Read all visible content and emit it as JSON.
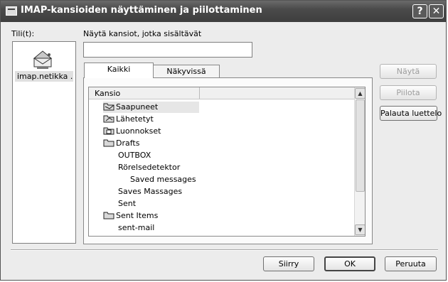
{
  "window": {
    "title": "IMAP-kansioiden näyttäminen ja piilottaminen"
  },
  "accounts": {
    "label": "Tili(t):",
    "items": [
      {
        "name": "imap.netikka ..."
      }
    ]
  },
  "search": {
    "label": "Näytä kansiot, jotka sisältävät",
    "value": ""
  },
  "tabs": [
    {
      "label": "Kaikki"
    },
    {
      "label": "Näkyvissä"
    }
  ],
  "folder_list": {
    "column_header": "Kansio",
    "rows": [
      {
        "name": "Saapuneet",
        "icon": "folder-icon"
      },
      {
        "name": "Lähetetyt",
        "icon": "folder-icon"
      },
      {
        "name": "Luonnokset",
        "icon": "folder-icon"
      },
      {
        "name": "Drafts",
        "icon": "folder-icon"
      },
      {
        "name": "OUTBOX",
        "icon": ""
      },
      {
        "name": "Rörelsedetektor",
        "icon": ""
      },
      {
        "name": "Saved messages",
        "icon": ""
      },
      {
        "name": "Saves Massages",
        "icon": ""
      },
      {
        "name": "Sent",
        "icon": ""
      },
      {
        "name": "Sent Items",
        "icon": "folder-icon"
      },
      {
        "name": "sent-mail",
        "icon": ""
      }
    ]
  },
  "side_buttons": {
    "show": "Näytä",
    "hide": "Piilota",
    "reset": "Palauta luettelo"
  },
  "footer_buttons": {
    "go": "Siirry",
    "ok": "OK",
    "cancel": "Peruuta"
  }
}
